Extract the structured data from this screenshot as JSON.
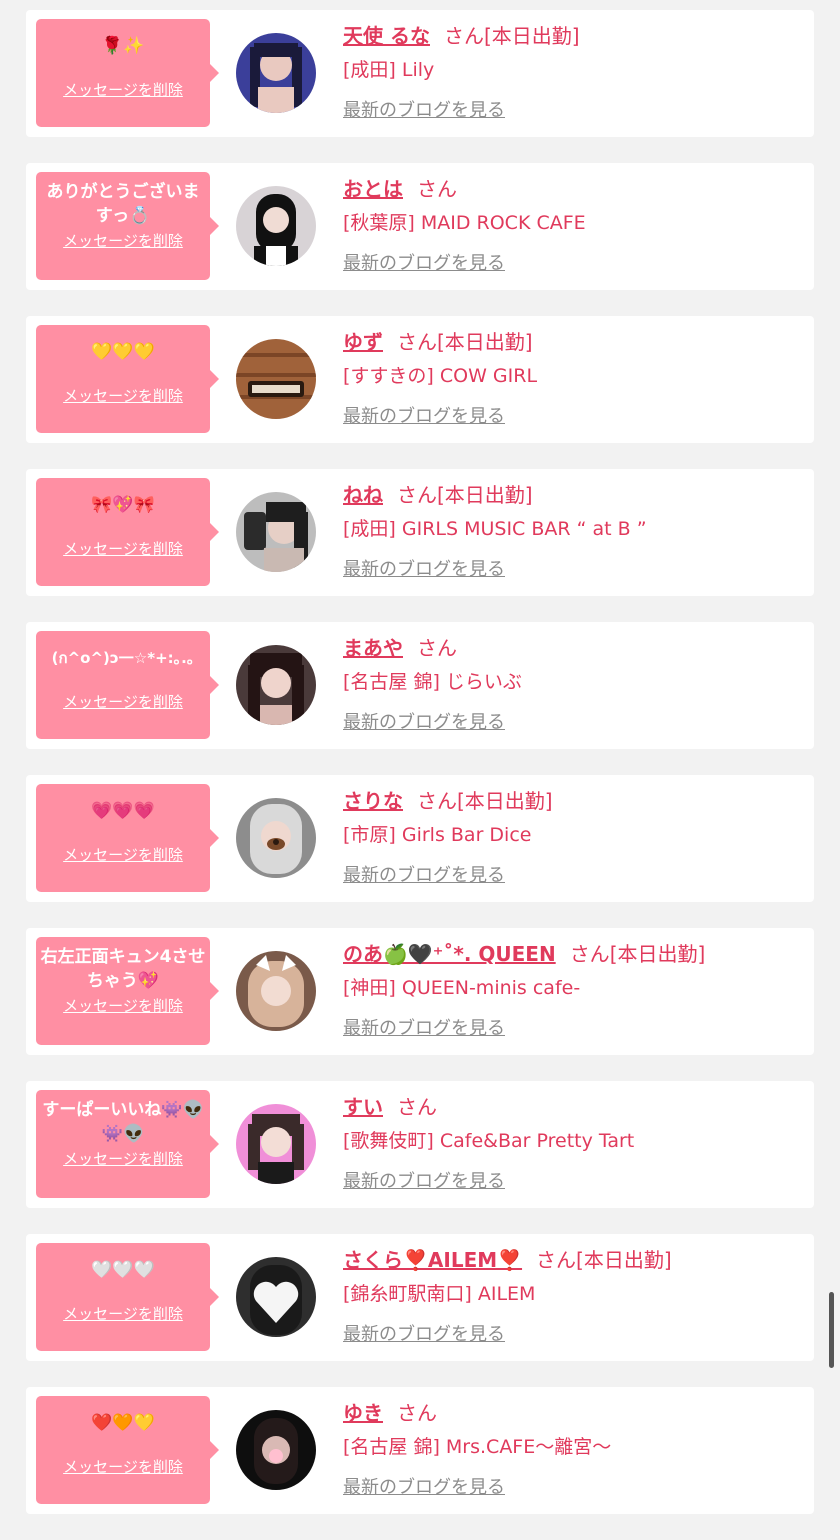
{
  "delete_label": "メッセージを削除",
  "blog_label": "最新のブログを見る",
  "san_label": "さん",
  "colors": {
    "bubble": "#ff8fa3",
    "accent": "#e03a5c",
    "muted": "#8c8c8c",
    "background": "#f2f2f2"
  },
  "favorites": [
    {
      "message": "🌹✨",
      "name": "天使 るな",
      "status": "[本日出勤]",
      "shop": "[成田] Lily",
      "avatar": "person-photo"
    },
    {
      "message": "ありがとうございますっ💍",
      "name": "おとは",
      "status": "",
      "shop": "[秋葉原] MAID ROCK CAFE",
      "avatar": "person-photo"
    },
    {
      "message": "💛💛💛",
      "name": "ゆず",
      "status": "[本日出勤]",
      "shop": "[すすきの] COW GIRL",
      "avatar": "shop-logo"
    },
    {
      "message": "🎀💖🎀",
      "name": "ねね",
      "status": "[本日出勤]",
      "shop": "[成田] GIRLS MUSIC BAR “ at B ”",
      "avatar": "person-photo"
    },
    {
      "message": "(ก^o^)ɔ一☆*+:｡.｡",
      "name": "まあや",
      "status": "",
      "shop": "[名古屋 錦] じらいぶ",
      "avatar": "person-photo"
    },
    {
      "message": "💗💗💗",
      "name": "さりな",
      "status": "[本日出勤]",
      "shop": "[市原] Girls Bar Dice",
      "avatar": "person-photo"
    },
    {
      "message": "右左正面キュン4させちゃう💖",
      "name": "のあ🍏🖤⁺˚*. QUEEN",
      "status": "[本日出勤]",
      "shop": "[神田] QUEEN-minis cafe-",
      "avatar": "person-photo"
    },
    {
      "message": "すーぱーいいね👾👽👾👽",
      "name": "すい",
      "status": "",
      "shop": "[歌舞伎町] Cafe&Bar Pretty Tart",
      "avatar": "person-photo"
    },
    {
      "message": "🤍🤍🤍",
      "name": "さくら❣️AILEM❣️",
      "status": "[本日出勤]",
      "shop": "[錦糸町駅南口] AILEM",
      "avatar": "person-photo"
    },
    {
      "message": "❤️🧡💛",
      "name": "ゆき",
      "status": "",
      "shop": "[名古屋 錦] Mrs.CAFE〜離宮〜",
      "avatar": "person-photo"
    }
  ]
}
